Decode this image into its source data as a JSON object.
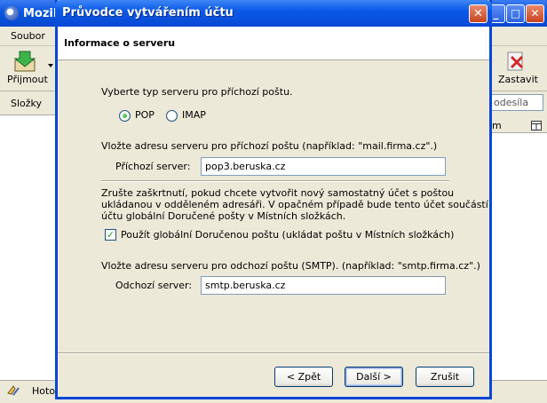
{
  "background_window": {
    "title": "Mozilla",
    "menu_file": "Soubor",
    "toolbar_get": "Přijmout",
    "toolbar_stop": "Zastavit",
    "folders_label": "Složky",
    "search_text": "odesíla",
    "column_header_text": "m",
    "status_text": "Hotov"
  },
  "dialog": {
    "title": "Průvodce vytvářením účtu",
    "heading": "Informace o serveru",
    "incoming_type_prompt": "Vyberte typ serveru pro příchozí poštu.",
    "radio_pop": "POP",
    "radio_imap": "IMAP",
    "selected_type": "POP",
    "incoming_server_prompt": "Vložte adresu serveru pro příchozí poštu (například: \"mail.firma.cz\".)",
    "incoming_server_label": "Příchozí server:",
    "incoming_server_value": "pop3.beruska.cz",
    "global_inbox_info_1": "Zrušte zaškrtnutí, pokud chcete vytvořit nový samostatný účet s poštou",
    "global_inbox_info_2": "ukládanou v odděleném adresáři. V opačném případě bude tento účet součástí",
    "global_inbox_info_3": "účtu globální Doručené pošty v Místních složkách.",
    "global_inbox_checkbox": "Použít globální Doručenou poštu (ukládat poštu v Místních složkách)",
    "global_inbox_checked": true,
    "outgoing_server_prompt": "Vložte adresu serveru pro odchozí poštu (SMTP). (například: \"smtp.firma.cz\".)",
    "outgoing_server_label": "Odchozí server:",
    "outgoing_server_value": "smtp.beruska.cz",
    "back_button": "< Zpět",
    "next_button": "Další >",
    "cancel_button": "Zrušit"
  }
}
